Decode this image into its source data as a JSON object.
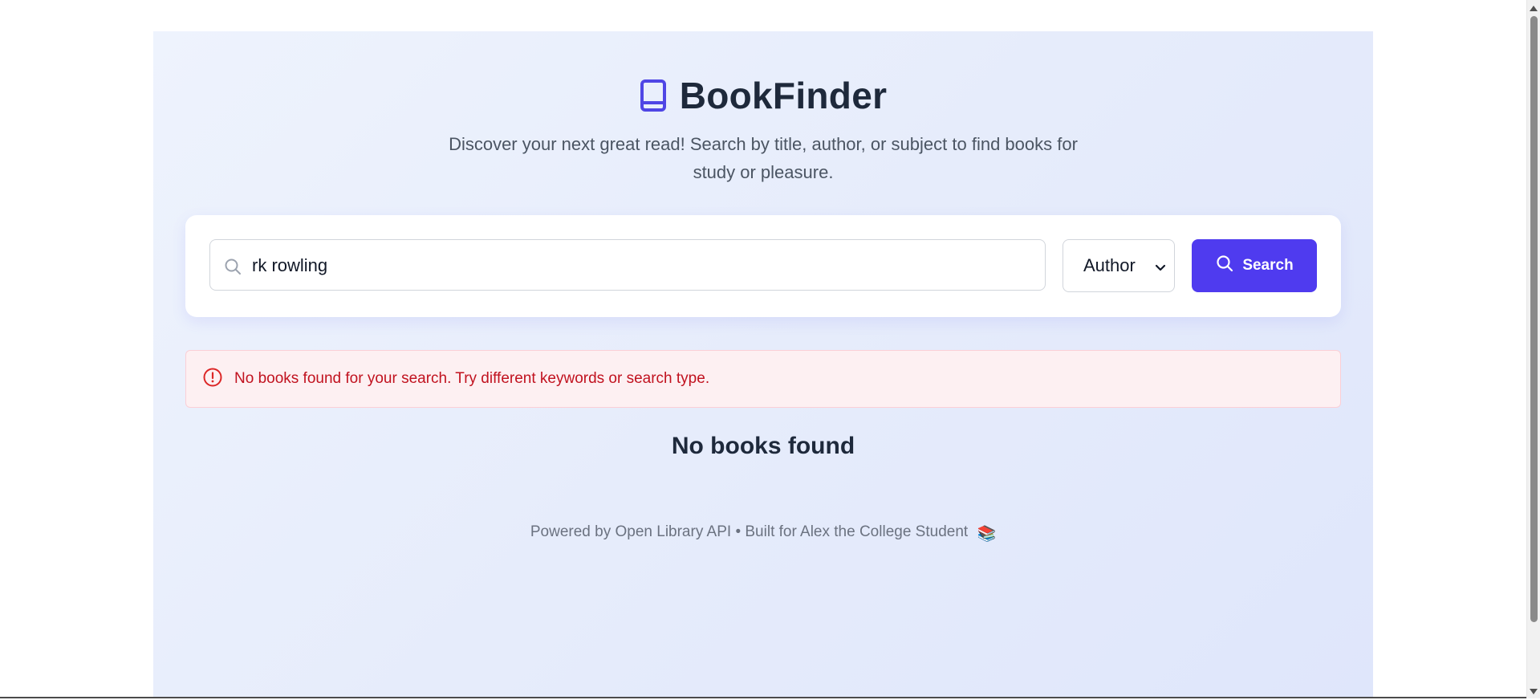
{
  "header": {
    "title": "BookFinder",
    "tagline": "Discover your next great read! Search by title, author, or subject to find books for study or pleasure."
  },
  "search": {
    "query": "rk rowling",
    "type_selected": "Author",
    "button_label": "Search"
  },
  "alert": {
    "message": "No books found for your search. Try different keywords or search type."
  },
  "results": {
    "empty_title": "No books found"
  },
  "footer": {
    "text": "Powered by Open Library API • Built for Alex the College Student",
    "emoji": "📚"
  },
  "colors": {
    "accent": "#4f3bef",
    "brand_icon": "#4f46e5",
    "error": "#c1121f",
    "heading": "#1e293b"
  },
  "icons": {
    "brand": "book-icon",
    "search_field": "search-icon",
    "button": "search-icon",
    "alert": "alert-circle-icon",
    "select": "chevron-down-icon"
  }
}
